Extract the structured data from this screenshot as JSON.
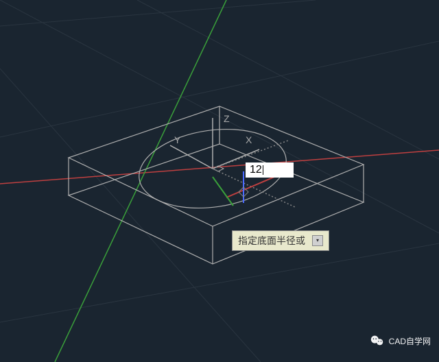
{
  "axes": {
    "x": "X",
    "y": "Y",
    "z": "Z"
  },
  "input": {
    "value": "12"
  },
  "tooltip": {
    "prompt": "指定底面半径或",
    "options_glyph": "▾"
  },
  "watermark": {
    "text": "CAD自学网"
  },
  "colors": {
    "background": "#1a2530",
    "wireframe": "#b0b0b0",
    "grid": "#2a3540",
    "axis_x_red": "#c04040",
    "axis_y_green": "#3aa03a",
    "gizmo_blue": "#4a6aff",
    "dotted": "#888888",
    "tooltip_bg": "#e8e8cc"
  }
}
